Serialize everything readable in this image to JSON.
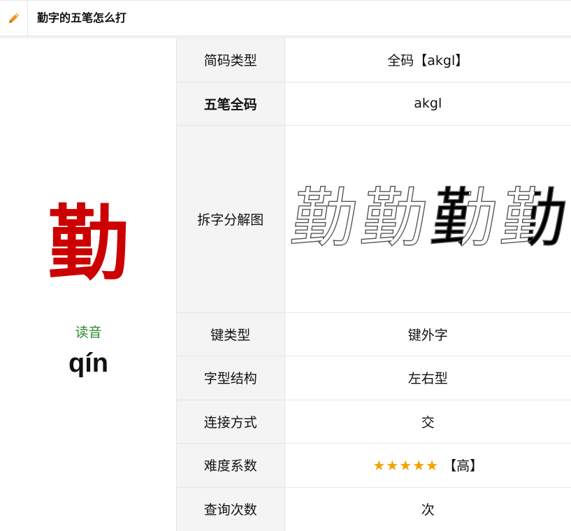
{
  "header": {
    "title": "勤字的五笔怎么打",
    "icon": "pencil-icon",
    "icon_color": "#f0921c"
  },
  "character": {
    "glyph": "勤",
    "color": "#cc0000",
    "reading_label": "读音",
    "pinyin": "qín"
  },
  "rows": [
    {
      "key": "简码类型",
      "value": "全码【akgl】"
    },
    {
      "key": "五笔全码",
      "value": "akgl"
    },
    {
      "key": "拆字分解图",
      "glyphs": [
        "勤",
        "勤",
        "勤",
        "勤"
      ]
    },
    {
      "key": "键类型",
      "value": "键外字"
    },
    {
      "key": "字型结构",
      "value": "左右型"
    },
    {
      "key": "连接方式",
      "value": "交"
    },
    {
      "key": "难度系数",
      "stars": "★★★★★",
      "star_count": 5,
      "level": "【高】"
    },
    {
      "key": "查询次数",
      "value": "次"
    }
  ],
  "colors": {
    "star": "#f5a000",
    "reading_label": "#2a8a2a"
  }
}
